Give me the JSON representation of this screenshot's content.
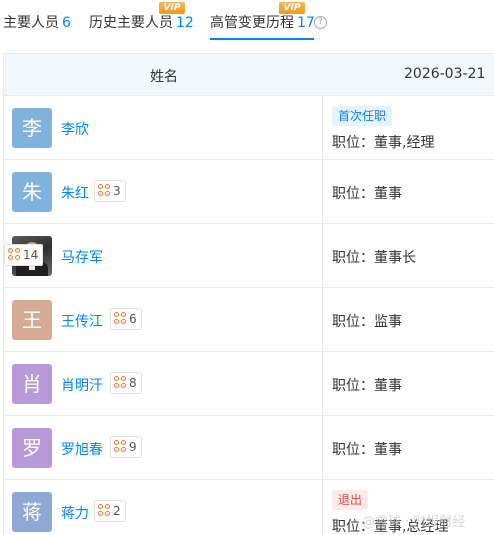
{
  "tabs": [
    {
      "label": "主要人员",
      "count": "6",
      "vip": ""
    },
    {
      "label": "历史主要人员",
      "count": "12",
      "vip": "VIP"
    },
    {
      "label": "高管变更历程",
      "count": "17",
      "vip": "VIP"
    }
  ],
  "help_icon": "?",
  "table": {
    "header_name": "姓名",
    "header_date": "2026-03-21",
    "rows": [
      {
        "avatar": "李",
        "avatar_color": "#7fb3dc",
        "name": "李欣",
        "relations": "",
        "tag": "首次任职",
        "position": "职位：董事,经理"
      },
      {
        "avatar": "朱",
        "avatar_color": "#7fb3dc",
        "name": "朱红",
        "relations": "3",
        "tag": "",
        "position": "职位：董事"
      },
      {
        "avatar": "",
        "avatar_color": "photo",
        "name": "马存军",
        "relations": "14",
        "tag": "",
        "position": "职位：董事长"
      },
      {
        "avatar": "王",
        "avatar_color": "#d6ab96",
        "name": "王传江",
        "relations": "6",
        "tag": "",
        "position": "职位：监事"
      },
      {
        "avatar": "肖",
        "avatar_color": "#b89ad8",
        "name": "肖明汗",
        "relations": "8",
        "tag": "",
        "position": "职位：董事"
      },
      {
        "avatar": "罗",
        "avatar_color": "#b89ad8",
        "name": "罗旭春",
        "relations": "9",
        "tag": "",
        "position": "职位：董事"
      },
      {
        "avatar": "蒋",
        "avatar_color": "#8fa8d4",
        "name": "蒋力",
        "relations": "2",
        "tag": "退出",
        "position": "职位：董事,总经理"
      }
    ]
  },
  "watermark": "@雪球 · 财报财经"
}
